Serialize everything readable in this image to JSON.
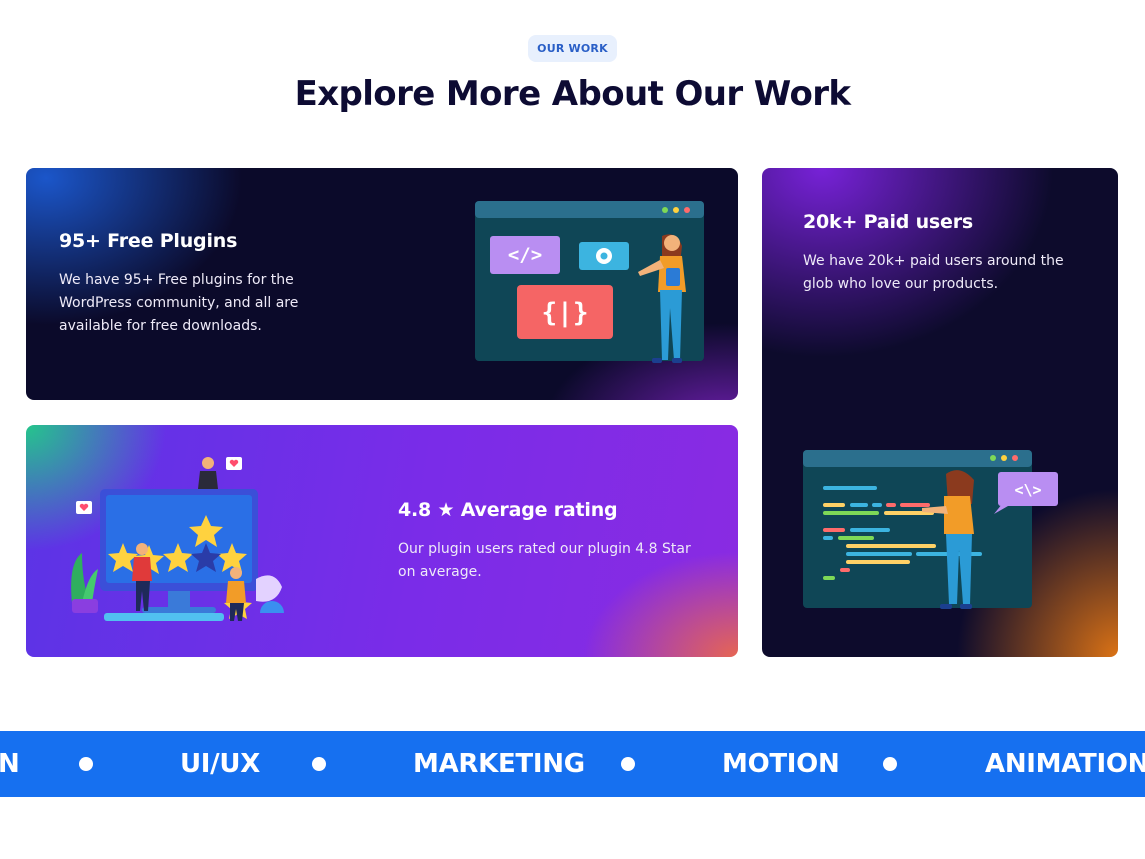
{
  "section": {
    "badge": "OUR WORK",
    "title": "Explore More About Our Work"
  },
  "cards": [
    {
      "title": "95+ Free Plugins",
      "text": "We have 95+ Free plugins for the WordPress community, and all are available for free downloads.",
      "illustration": "code-window-illustration",
      "code_tags": [
        "</>",
        "{|}"
      ]
    },
    {
      "title": "20k+ Paid users",
      "text": "We have 20k+ paid users around the glob who love our products.",
      "illustration": "code-editor-illustration",
      "bubble_text": "<\\>"
    },
    {
      "title": "4.8 ★ Average rating",
      "text": "Our plugin users rated our plugin 4.8 Star on average.",
      "illustration": "rating-stars-illustration"
    }
  ],
  "ticker": {
    "items": [
      "N",
      "UI/UX",
      "MARKETING",
      "MOTION",
      "ANIMATION"
    ],
    "separator_icon": "dot-icon"
  },
  "colors": {
    "heading": "#0d0b33",
    "badge_bg": "#e8f0fd",
    "badge_text": "#2a5fc7",
    "ticker_bg": "#1670f0"
  }
}
